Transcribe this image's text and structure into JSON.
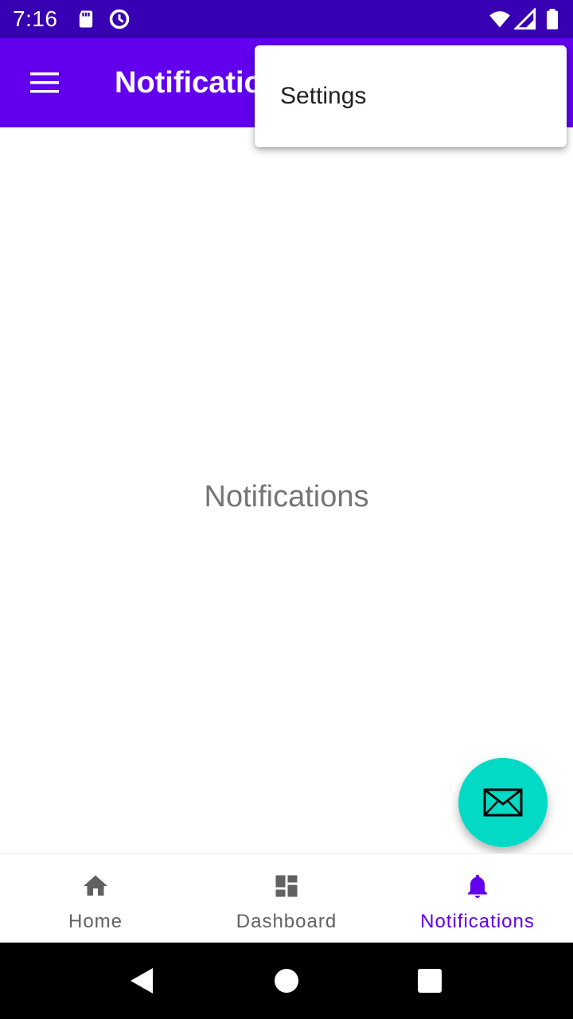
{
  "status_bar": {
    "time": "7:16",
    "icons": [
      "sd-card-icon",
      "data-saver-icon",
      "wifi-icon",
      "signal-icon",
      "battery-icon"
    ]
  },
  "app_bar": {
    "title": "Notifications",
    "menu_icon": "hamburger-menu-icon"
  },
  "overflow_menu": {
    "items": [
      {
        "label": "Settings"
      }
    ]
  },
  "content": {
    "text": "Notifications"
  },
  "fab": {
    "icon": "mail-icon"
  },
  "bottom_nav": {
    "items": [
      {
        "label": "Home",
        "icon": "home-icon",
        "selected": false
      },
      {
        "label": "Dashboard",
        "icon": "dashboard-icon",
        "selected": false
      },
      {
        "label": "Notifications",
        "icon": "bell-icon",
        "selected": true
      }
    ]
  },
  "system_nav": {
    "buttons": [
      "back-icon",
      "home-circle-icon",
      "recents-icon"
    ]
  },
  "colors": {
    "primary": "#6200ee",
    "primary_dark": "#3700b3",
    "accent": "#03dac5",
    "nav_inactive": "#616161"
  }
}
